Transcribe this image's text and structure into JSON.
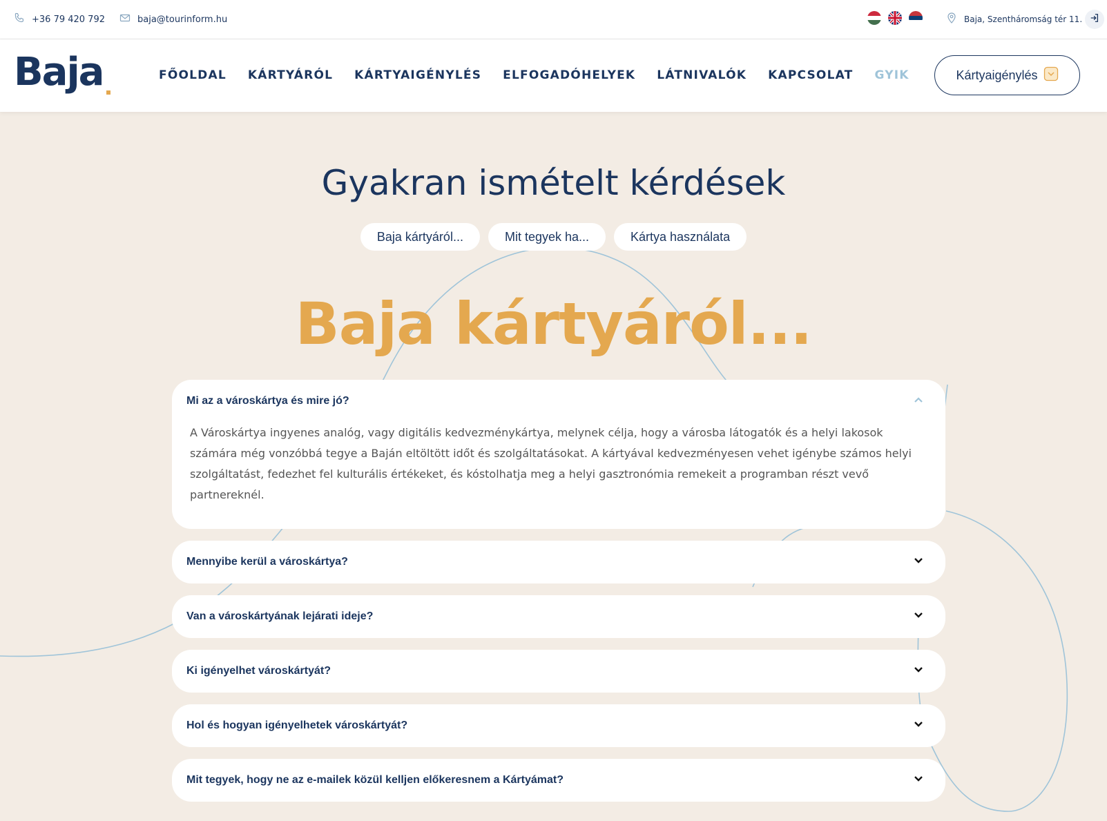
{
  "topbar": {
    "phone": "+36 79 420 792",
    "email": "baja@tourinform.hu",
    "address": "Baja, Szentháromság tér 11.",
    "languages": [
      "hu",
      "en",
      "rs"
    ]
  },
  "header": {
    "logo_text": "Baja",
    "nav": [
      "FŐOLDAL",
      "KÁRTYÁRÓL",
      "KÁRTYAIGÉNYLÉS",
      "ELFOGADÓHELYEK",
      "LÁTNIVALÓK",
      "KAPCSOLAT",
      "GYIK"
    ],
    "active_nav": "GYIK",
    "cta_label": "Kártyaigénylés"
  },
  "main": {
    "title": "Gyakran ismételt kérdések",
    "pills": [
      "Baja kártyáról...",
      "Mit tegyek ha...",
      "Kártya használata"
    ],
    "section_title": "Baja kártyáról...",
    "faqs": [
      {
        "question": "Mi az a városkártya és mire jó?",
        "answer": "A Városkártya ingyenes analóg, vagy digitális kedvezménykártya, melynek célja, hogy a városba látogatók és a helyi lakosok számára még vonzóbbá tegye a Baján eltöltött időt és szolgáltatásokat. A kártyával kedvezményesen vehet igénybe számos helyi szolgáltatást, fedezhet fel kulturális értékeket, és kóstolhatja meg a helyi gasztronómia remekeit a programban részt vevő partnereknél.",
        "open": true
      },
      {
        "question": "Mennyibe kerül a városkártya?",
        "open": false
      },
      {
        "question": "Van a városkártyának lejárati ideje?",
        "open": false
      },
      {
        "question": "Ki igényelhet városkártyát?",
        "open": false
      },
      {
        "question": "Hol és hogyan igényelhetek városkártyát?",
        "open": false
      },
      {
        "question": "Mit tegyek, hogy ne az e-mailek közül kelljen előkeresnem a Kártyámat?",
        "open": false
      }
    ]
  },
  "colors": {
    "navy": "#1b355e",
    "accent_orange": "#e4a84f",
    "accent_light_blue": "#9fc4d9",
    "background": "#f3ece4"
  }
}
